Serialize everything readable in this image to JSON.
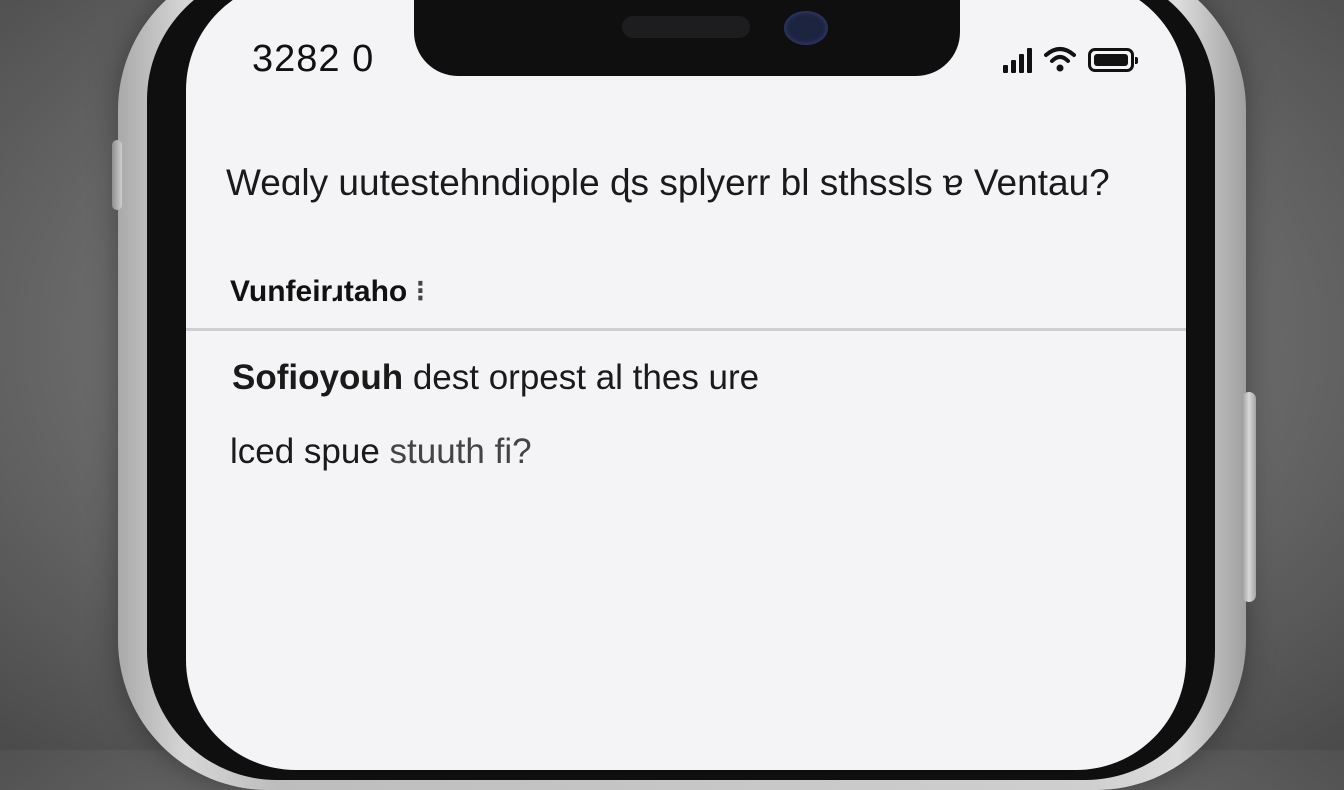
{
  "status_bar": {
    "time": "3282 0",
    "signal_icon": "cellular-signal-icon",
    "wifi_icon": "wifi-icon",
    "battery_icon": "battery-icon"
  },
  "content": {
    "question": "Weɑly uutestehndiople ɖs splyerr bl sthssls ɐ Ventau?",
    "section_label": "Vunfeirɹtaho",
    "section_marker": "⁝",
    "answer_line1_bold": "Sofioyouh",
    "answer_line1_rest": " dest orpest al thes ure",
    "answer_line2_bold": "lced spue",
    "answer_line2_rest": " stuuth fi?"
  }
}
